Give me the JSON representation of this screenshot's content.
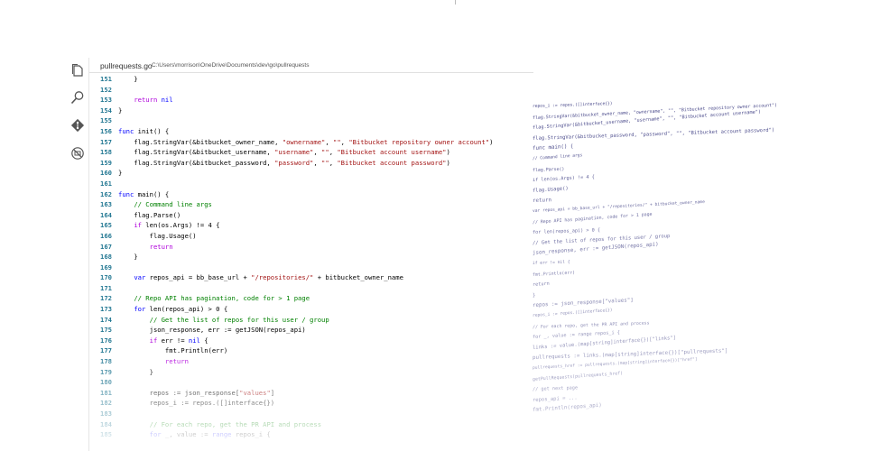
{
  "tab": {
    "filename": "pullrequests.go",
    "path": "C:\\Users\\morrison\\OneDrive\\Documents\\dev\\go\\pullrequests"
  },
  "activity_icons": [
    "files-icon",
    "search-icon",
    "source-control-icon",
    "extensions-icon"
  ],
  "code_lines": [
    {
      "n": "151",
      "text": "    }"
    },
    {
      "n": "152",
      "text": ""
    },
    {
      "n": "153",
      "text": "    return nil"
    },
    {
      "n": "154",
      "text": "}"
    },
    {
      "n": "155",
      "text": ""
    },
    {
      "n": "156",
      "text": "func init() {"
    },
    {
      "n": "157",
      "text": "    flag.StringVar(&bitbucket_owner_name, \"ownername\", \"\", \"Bitbucket repository owner account\")"
    },
    {
      "n": "158",
      "text": "    flag.StringVar(&bitbucket_username, \"username\", \"\", \"Bitbucket account username\")"
    },
    {
      "n": "159",
      "text": "    flag.StringVar(&bitbucket_password, \"password\", \"\", \"Bitbucket account password\")"
    },
    {
      "n": "160",
      "text": "}"
    },
    {
      "n": "161",
      "text": ""
    },
    {
      "n": "162",
      "text": "func main() {"
    },
    {
      "n": "163",
      "text": "    // Command line args"
    },
    {
      "n": "164",
      "text": "    flag.Parse()"
    },
    {
      "n": "165",
      "text": "    if len(os.Args) != 4 {"
    },
    {
      "n": "166",
      "text": "        flag.Usage()"
    },
    {
      "n": "167",
      "text": "        return"
    },
    {
      "n": "168",
      "text": "    }"
    },
    {
      "n": "169",
      "text": ""
    },
    {
      "n": "170",
      "text": "    var repos_api = bb_base_url + \"/repositories/\" + bitbucket_owner_name"
    },
    {
      "n": "171",
      "text": ""
    },
    {
      "n": "172",
      "text": "    // Repo API has pagination, code for > 1 page"
    },
    {
      "n": "173",
      "text": "    for len(repos_api) > 0 {"
    },
    {
      "n": "174",
      "text": "        // Get the list of repos for this user / group"
    },
    {
      "n": "175",
      "text": "        json_response, err := getJSON(repos_api)"
    },
    {
      "n": "176",
      "text": "        if err != nil {"
    },
    {
      "n": "177",
      "text": "            fmt.Println(err)"
    },
    {
      "n": "178",
      "text": "            return"
    },
    {
      "n": "179",
      "text": "        }"
    },
    {
      "n": "180",
      "text": ""
    },
    {
      "n": "181",
      "text": "        repos := json_response[\"values\"]"
    },
    {
      "n": "182",
      "text": "        repos_i := repos.([]interface{})"
    },
    {
      "n": "183",
      "text": ""
    },
    {
      "n": "184",
      "text": "        // For each repo, get the PR API and process"
    },
    {
      "n": "185",
      "text": "        for _, value := range repos_i {"
    }
  ],
  "perspective_lines": [
    "repos_i := repos.([]interface{})",
    "flag.StringVar(&bitbucket_owner_name, \"ownername\", \"\", \"Bitbucket repository owner account\")",
    "flag.StringVar(&bitbucket_username, \"username\", \"\", \"Bitbucket account username\")",
    "flag.StringVar(&bitbucket_password, \"password\", \"\", \"Bitbucket account password\")",
    "func main() {",
    "    // Command line args",
    "    flag.Parse()",
    "    if len(os.Args) != 4 {",
    "        flag.Usage()",
    "        return",
    "var repos_api = bb_base_url + \"/repositories/\" + bitbucket_owner_name",
    "// Repo API has pagination, code for > 1 page",
    "for len(repos_api) > 0 {",
    "    // Get the list of repos for this user / group",
    "    json_response, err := getJSON(repos_api)",
    "    if err != nil {",
    "        fmt.Println(err)",
    "        return",
    "    }",
    "    repos := json_response[\"values\"]",
    "    repos_i := repos.([]interface{})",
    "    // For each repo, get the PR API and process",
    "    for _, value := range repos_i {",
    "        links := value.(map[string]interface{})[\"links\"]",
    "        pullrequests := links.(map[string]interface{})[\"pullrequests\"]",
    "        pullrequests_href := pullrequests.(map[string]interface{})[\"href\"]",
    "        getPullRequests(pullrequests_href)",
    "        // get next page",
    "        repos_api = ...",
    "        fmt.Println(repos_api)"
  ]
}
